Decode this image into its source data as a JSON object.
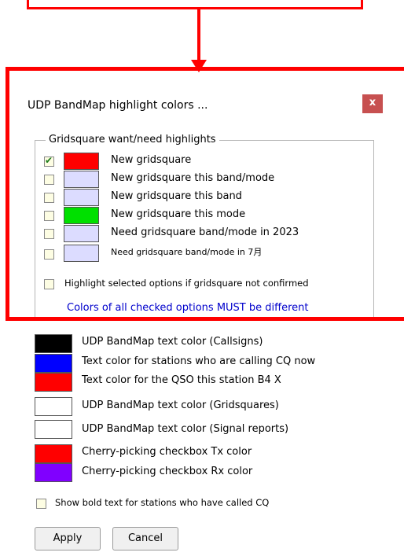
{
  "dialog": {
    "title": "UDP BandMap highlight colors ...",
    "close_label": "x"
  },
  "group": {
    "title": "Gridsquare want/need highlights",
    "rows": [
      {
        "label": "New gridsquare",
        "checked": true,
        "color": "#ff0000"
      },
      {
        "label": "New gridsquare this band/mode",
        "checked": false,
        "color": "#dcdcff"
      },
      {
        "label": "New gridsquare this band",
        "checked": false,
        "color": "#dcdcff"
      },
      {
        "label": "New gridsquare this mode",
        "checked": false,
        "color": "#00e000"
      },
      {
        "label": "Need gridsquare band/mode in 2023",
        "checked": false,
        "color": "#dcdcff"
      },
      {
        "label": "Need gridsquare band/mode in 7月",
        "checked": false,
        "color": "#dcdcff"
      }
    ],
    "highlight_unconfirmed_label": "Highlight selected options if gridsquare not confirmed",
    "note": "Colors of all checked options MUST be different"
  },
  "colors": [
    {
      "label": "UDP BandMap text color (Callsigns)",
      "color": "#000000"
    },
    {
      "label": "Text color for stations who are calling CQ now",
      "color": "#0000ff"
    },
    {
      "label": "Text color for the QSO this station B4 X",
      "color": "#ff0000"
    },
    {
      "label": "UDP BandMap text color (Gridsquares)",
      "color": "#ffffff"
    },
    {
      "label": "UDP BandMap text color (Signal reports)",
      "color": "#ffffff"
    },
    {
      "label": "Cherry-picking checkbox Tx color",
      "color": "#ff0000"
    },
    {
      "label": "Cherry-picking checkbox Rx color",
      "color": "#8000ff"
    }
  ],
  "bold_cq_label": "Show bold text for stations who have called CQ",
  "buttons": {
    "apply": "Apply",
    "cancel": "Cancel"
  }
}
